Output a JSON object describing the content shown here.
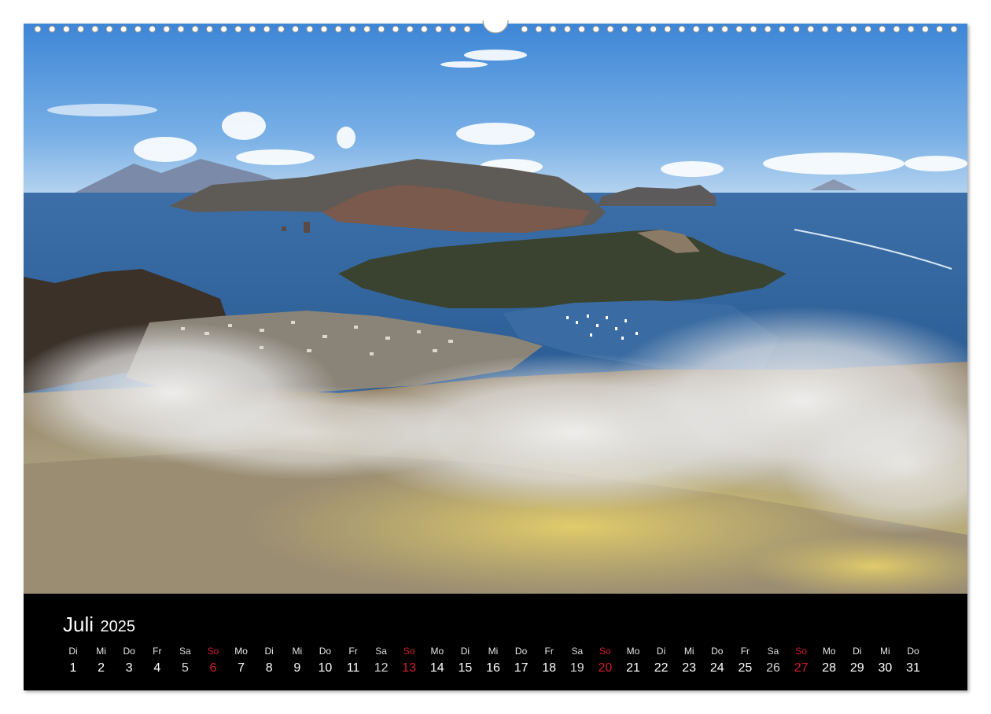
{
  "calendar": {
    "month": "Juli",
    "year": "2025",
    "sunday_color": "#d2202a",
    "days": [
      {
        "wd": "Di",
        "n": "1"
      },
      {
        "wd": "Mi",
        "n": "2"
      },
      {
        "wd": "Do",
        "n": "3"
      },
      {
        "wd": "Fr",
        "n": "4"
      },
      {
        "wd": "Sa",
        "n": "5"
      },
      {
        "wd": "So",
        "n": "6"
      },
      {
        "wd": "Mo",
        "n": "7"
      },
      {
        "wd": "Di",
        "n": "8"
      },
      {
        "wd": "Mi",
        "n": "9"
      },
      {
        "wd": "Do",
        "n": "10"
      },
      {
        "wd": "Fr",
        "n": "11"
      },
      {
        "wd": "Sa",
        "n": "12"
      },
      {
        "wd": "So",
        "n": "13"
      },
      {
        "wd": "Mo",
        "n": "14"
      },
      {
        "wd": "Di",
        "n": "15"
      },
      {
        "wd": "Mi",
        "n": "16"
      },
      {
        "wd": "Do",
        "n": "17"
      },
      {
        "wd": "Fr",
        "n": "18"
      },
      {
        "wd": "Sa",
        "n": "19"
      },
      {
        "wd": "So",
        "n": "20"
      },
      {
        "wd": "Mo",
        "n": "21"
      },
      {
        "wd": "Di",
        "n": "22"
      },
      {
        "wd": "Mi",
        "n": "23"
      },
      {
        "wd": "Do",
        "n": "24"
      },
      {
        "wd": "Fr",
        "n": "25"
      },
      {
        "wd": "Sa",
        "n": "26"
      },
      {
        "wd": "So",
        "n": "27"
      },
      {
        "wd": "Mo",
        "n": "28"
      },
      {
        "wd": "Di",
        "n": "29"
      },
      {
        "wd": "Mi",
        "n": "30"
      },
      {
        "wd": "Do",
        "n": "31"
      }
    ]
  }
}
